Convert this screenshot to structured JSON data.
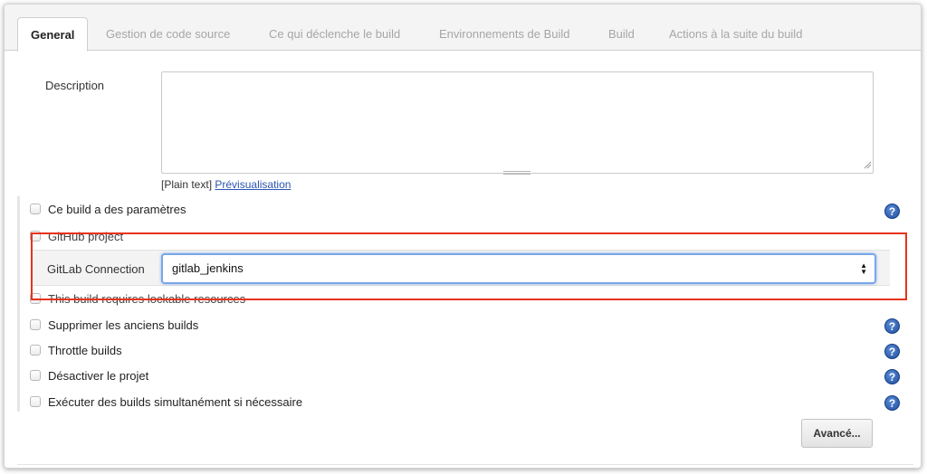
{
  "tabs": [
    {
      "label": "General",
      "active": true
    },
    {
      "label": "Gestion de code source",
      "active": false
    },
    {
      "label": "Ce qui déclenche le build",
      "active": false
    },
    {
      "label": "Environnements de Build",
      "active": false
    },
    {
      "label": "Build",
      "active": false
    },
    {
      "label": "Actions à la suite du build",
      "active": false
    }
  ],
  "description": {
    "label": "Description",
    "value": "",
    "format_prefix": "[Plain text]",
    "preview_link": "Prévisualisation"
  },
  "options": {
    "parameters": "Ce build a des paramètres",
    "github_project": "GitHub project",
    "lockable_resources": "This build requires lockable resources",
    "discard_old": "Supprimer les anciens builds",
    "throttle": "Throttle builds",
    "disable": "Désactiver le projet",
    "concurrent": "Exécuter des builds simultanément si nécessaire"
  },
  "gitlab": {
    "label": "GitLab Connection",
    "selected": "gitlab_jenkins"
  },
  "advanced_button": "Avancé...",
  "icons": {
    "help": "help-icon",
    "select_arrows": "select-arrows-icon",
    "resize": "resize-handle-icon"
  },
  "colors": {
    "highlight_border": "#e8321d",
    "help_icon": "#2a5bb0",
    "link": "#2b55b2",
    "select_focus": "#79a6e8"
  }
}
